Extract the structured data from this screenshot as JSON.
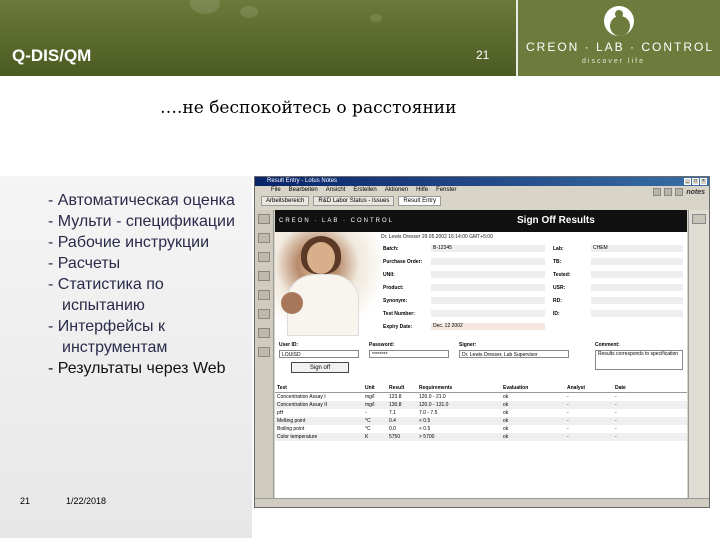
{
  "header": {
    "title": "Q-DIS/QM",
    "slide_number": "21",
    "brand_name": "CREON · LAB · CONTROL",
    "brand_sub": "discover life"
  },
  "subtitle": "….не беспокойтесь о расстоянии",
  "bullets": [
    "- Автоматическая оценка",
    "- Мульти - спецификации",
    "- Рабочие инструкции",
    "- Расчеты",
    "- Статистика по испытанию",
    "- Интерфейсы к инструментам",
    "- Результаты через Web"
  ],
  "footer": {
    "number": "21",
    "date": "1/22/2018"
  },
  "window": {
    "title": "Result Entry - Lotus Notes",
    "menu": [
      "File",
      "Bearbeiten",
      "Ansicht",
      "Erstellen",
      "Aktionen",
      "Hilfe",
      "Fenster"
    ],
    "tabs": [
      "Arbeitsbereich",
      "R&D Labor Status - Issues",
      "Result Entry"
    ],
    "notes_logo": "notes",
    "content": {
      "banner_logo": "CREON · LAB · CONTROL",
      "banner_title": "Sign Off Results",
      "signed_line": "Dr. Lewis Dresser 29.05.2002 16:14:00 GMT+5:00",
      "fields_left": [
        {
          "label": "Batch:",
          "value": "B-12345"
        },
        {
          "label": "Purchase Order:",
          "value": ""
        },
        {
          "label": "UNII:",
          "value": ""
        },
        {
          "label": "Product:",
          "value": ""
        },
        {
          "label": "Synonym:",
          "value": ""
        },
        {
          "label": "Test Number:",
          "value": ""
        },
        {
          "label": "Expiry Date:",
          "value": "Dec. 12 2002"
        }
      ],
      "fields_right": [
        {
          "label": "Lab:",
          "value": "CHEM"
        },
        {
          "label": "TB:",
          "value": ""
        },
        {
          "label": "Tested:",
          "value": ""
        },
        {
          "label": "USR:",
          "value": ""
        },
        {
          "label": "RD:",
          "value": ""
        },
        {
          "label": "ID:",
          "value": ""
        }
      ],
      "bottom_labels": {
        "user_id": "User ID:",
        "password": "Password:",
        "signer": "Signer:",
        "comment": "Comment:"
      },
      "bottom_values": {
        "user_id": "LOUISD",
        "password": "********",
        "signer": "Dr. Lewis Dresser, Lab Supervisor",
        "comment": "Results corresponds to specification"
      },
      "signoff_label": "Sign off",
      "table": {
        "headers": [
          "Test",
          "Unit",
          "Result",
          "Requirements",
          "Evaluation",
          "Analyst",
          "Date"
        ],
        "rows": [
          [
            "Concentration Assay I",
            "mg/l",
            "123.8",
            "120.0 - 21.0",
            "ok",
            "-",
            "-"
          ],
          [
            "Concentration Assay II",
            "mg/l",
            "130.8",
            "120.0 - 131.0",
            "ok",
            "-",
            "-"
          ],
          [
            "pH",
            "-",
            "7.1",
            "7.0 - 7.5",
            "ok",
            "-",
            "-"
          ],
          [
            "Melting point",
            "°C",
            "0.4",
            "< 0.5",
            "ok",
            "-",
            "-"
          ],
          [
            "Boiling point",
            "°C",
            "0.0",
            "< 0.5",
            "ok",
            "-",
            "-"
          ],
          [
            "Color temperature",
            "K",
            "5750",
            "> 5700",
            "ok",
            "-",
            "-"
          ]
        ]
      }
    }
  }
}
